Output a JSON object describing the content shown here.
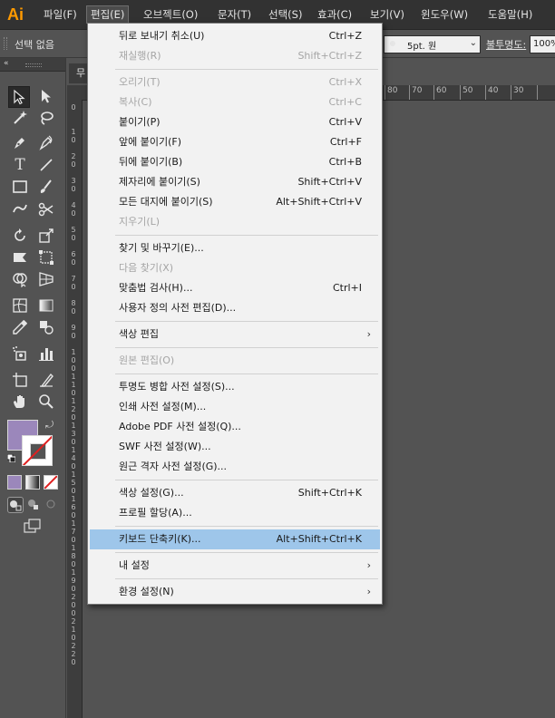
{
  "app": {
    "logo": "Ai",
    "menus": [
      {
        "label": "파일(F)",
        "active": false
      },
      {
        "label": "편집(E)",
        "active": true
      },
      {
        "label": "오브젝트(O)",
        "active": false
      },
      {
        "label": "문자(T)",
        "active": false
      },
      {
        "label": "선택(S)",
        "active": false
      },
      {
        "label": "효과(C)",
        "active": false
      },
      {
        "label": "보기(V)",
        "active": false
      },
      {
        "label": "윈도우(W)",
        "active": false
      },
      {
        "label": "도움말(H)",
        "active": false
      }
    ]
  },
  "control_bar": {
    "selection_status": "선택 없음",
    "stroke_weight": "5pt. 원",
    "opacity_label": "불투명도:",
    "opacity_value": "100%"
  },
  "document": {
    "tab_label": "무",
    "ruler_h_labels": [
      "80",
      "70",
      "60",
      "50",
      "40",
      "30"
    ],
    "ruler_v_labels": [
      "0",
      "1 0",
      "2 0",
      "3 0",
      "4 0",
      "5 0",
      "6 0",
      "7 0",
      "8 0",
      "9 0",
      "1 0 0",
      "1 1 0",
      "1 2 0",
      "1 3 0",
      "1 4 0",
      "1 5 0",
      "1 6 0",
      "1 7 0",
      "1 8 0",
      "1 9 0",
      "2 0 0",
      "2 1 0",
      "2 2 0"
    ]
  },
  "tools": {
    "fill_color": "#9b87bb",
    "stroke_color": "none"
  },
  "edit_menu": {
    "items": [
      {
        "label": "뒤로 보내기 취소(U)",
        "shortcut": "Ctrl+Z",
        "enabled": true
      },
      {
        "label": "재실행(R)",
        "shortcut": "Shift+Ctrl+Z",
        "enabled": false
      },
      {
        "separator": true
      },
      {
        "label": "오리기(T)",
        "shortcut": "Ctrl+X",
        "enabled": false
      },
      {
        "label": "복사(C)",
        "shortcut": "Ctrl+C",
        "enabled": false
      },
      {
        "label": "붙이기(P)",
        "shortcut": "Ctrl+V",
        "enabled": true
      },
      {
        "label": "앞에 붙이기(F)",
        "shortcut": "Ctrl+F",
        "enabled": true
      },
      {
        "label": "뒤에 붙이기(B)",
        "shortcut": "Ctrl+B",
        "enabled": true
      },
      {
        "label": "제자리에 붙이기(S)",
        "shortcut": "Shift+Ctrl+V",
        "enabled": true
      },
      {
        "label": "모든 대지에 붙이기(S)",
        "shortcut": "Alt+Shift+Ctrl+V",
        "enabled": true
      },
      {
        "label": "지우기(L)",
        "shortcut": "",
        "enabled": false
      },
      {
        "separator": true
      },
      {
        "label": "찾기 및 바꾸기(E)...",
        "shortcut": "",
        "enabled": true
      },
      {
        "label": "다음 찾기(X)",
        "shortcut": "",
        "enabled": false
      },
      {
        "label": "맞춤법 검사(H)...",
        "shortcut": "Ctrl+I",
        "enabled": true
      },
      {
        "label": "사용자 정의 사전 편집(D)...",
        "shortcut": "",
        "enabled": true
      },
      {
        "separator": true
      },
      {
        "label": "색상 편집",
        "shortcut": "",
        "enabled": true,
        "submenu": true
      },
      {
        "separator": true
      },
      {
        "label": "원본 편집(O)",
        "shortcut": "",
        "enabled": false
      },
      {
        "separator": true
      },
      {
        "label": "투명도 병합 사전 설정(S)...",
        "shortcut": "",
        "enabled": true
      },
      {
        "label": "인쇄 사전 설정(M)...",
        "shortcut": "",
        "enabled": true
      },
      {
        "label": "Adobe PDF 사전 설정(Q)...",
        "shortcut": "",
        "enabled": true
      },
      {
        "label": "SWF 사전 설정(W)...",
        "shortcut": "",
        "enabled": true
      },
      {
        "label": "원근 격자 사전 설정(G)...",
        "shortcut": "",
        "enabled": true
      },
      {
        "separator": true
      },
      {
        "label": "색상 설정(G)...",
        "shortcut": "Shift+Ctrl+K",
        "enabled": true
      },
      {
        "label": "프로필 할당(A)...",
        "shortcut": "",
        "enabled": true
      },
      {
        "separator": true
      },
      {
        "label": "키보드 단축키(K)...",
        "shortcut": "Alt+Shift+Ctrl+K",
        "enabled": true,
        "highlighted": true
      },
      {
        "separator": true
      },
      {
        "label": "내 설정",
        "shortcut": "",
        "enabled": true,
        "submenu": true
      },
      {
        "separator": true
      },
      {
        "label": "환경 설정(N)",
        "shortcut": "",
        "enabled": true,
        "submenu": true
      }
    ]
  }
}
